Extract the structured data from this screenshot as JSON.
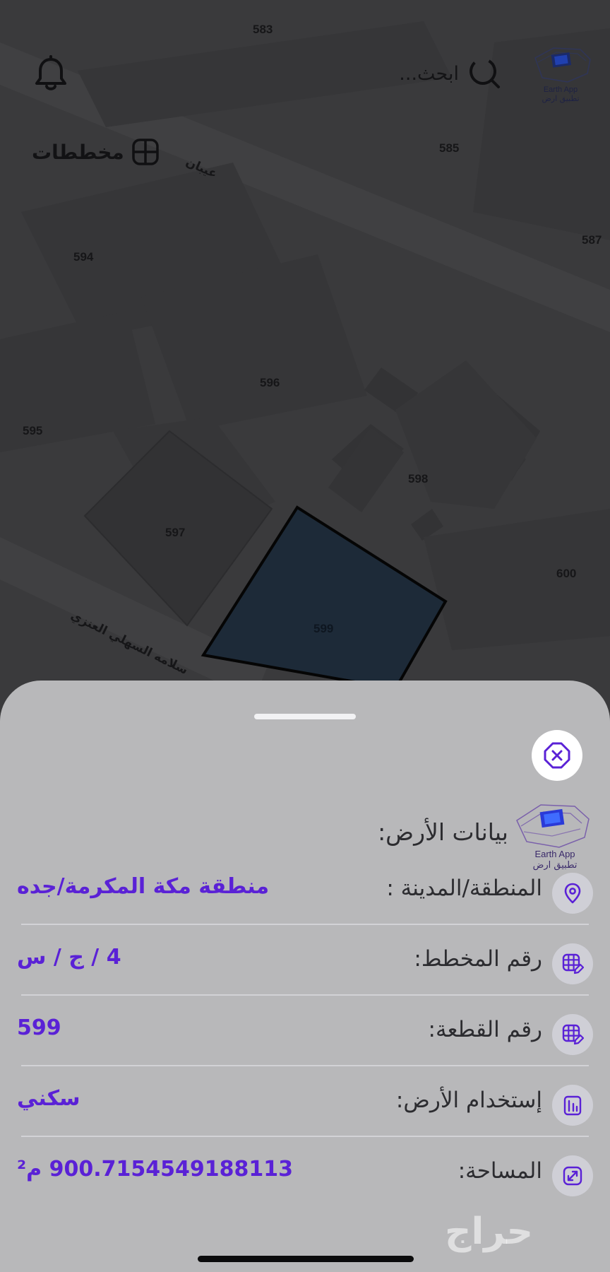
{
  "map": {
    "plots": [
      "583",
      "585",
      "587",
      "594",
      "595",
      "596",
      "597",
      "598",
      "599",
      "600"
    ],
    "streets": [
      "عيبان",
      "سلامه السهلي العنزي"
    ],
    "selected_plot_color": "#1d2a38",
    "background_color": "#3a3a3c"
  },
  "topbar": {
    "search_placeholder": "ابحث...",
    "logo_text_en": "Earth App",
    "logo_text_ar": "تطبيق ارض",
    "plans_label": "مخططات"
  },
  "sheet": {
    "title": "بيانات الأرض:",
    "logo_text_en": "Earth App",
    "logo_text_ar": "تطبيق ارض",
    "rows": [
      {
        "label": "المنطقة/المدينة :",
        "value": "منطقة مكة المكرمة/جده",
        "icon": "location-pin-icon"
      },
      {
        "label": "رقم المخطط:",
        "value": "4 / ج / س",
        "icon": "grid-edit-icon"
      },
      {
        "label": "رقم القطعة:",
        "value": "599",
        "icon": "grid-edit-icon"
      },
      {
        "label": "إستخدام الأرض:",
        "value": "سكني",
        "icon": "building-icon"
      },
      {
        "label": "المساحة:",
        "value": "900.7154549188113 م²",
        "icon": "expand-arrows-icon"
      }
    ],
    "accent_color": "#5a21d6",
    "watermark": "حراج"
  }
}
